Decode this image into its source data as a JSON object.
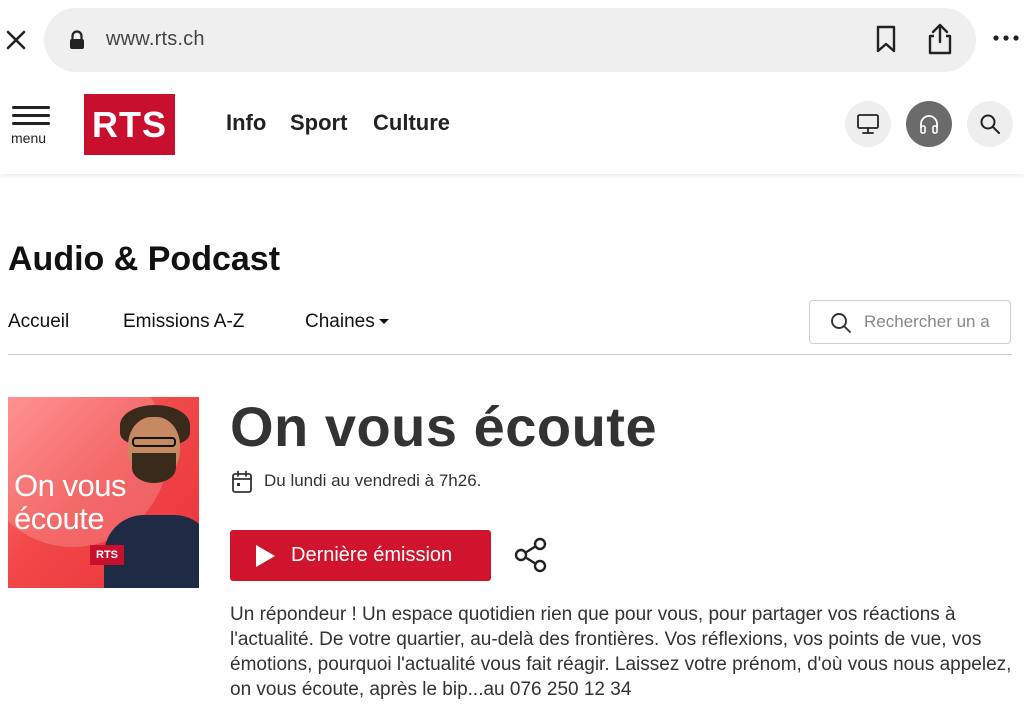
{
  "browser": {
    "url": "www.rts.ch"
  },
  "header": {
    "menu_label": "menu",
    "logo_text": "RTS",
    "nav": [
      "Info",
      "Sport",
      "Culture"
    ]
  },
  "section": {
    "title": "Audio & Podcast",
    "subnav": [
      "Accueil",
      "Emissions A-Z",
      "Chaines"
    ],
    "search_placeholder": "Rechercher un a"
  },
  "show": {
    "cover_title_line1": "On vous",
    "cover_title_line2": "écoute",
    "cover_badge": "RTS",
    "title": "On vous écoute",
    "schedule": "Du lundi au vendredi à 7h26.",
    "play_label": "Dernière émission",
    "description": "Un répondeur ! Un espace quotidien rien que pour vous, pour partager vos réactions à l'actualité. De votre quartier, au-delà des frontières. Vos réflexions, vos points de vue, vos émotions, pourquoi l'actualité vous fait réagir. Laissez votre prénom, d'où vous nous appelez, on vous écoute, après le bip...au 076 250 12 34"
  },
  "colors": {
    "brand_red": "#d0142d",
    "logo_red": "#c8102e"
  }
}
